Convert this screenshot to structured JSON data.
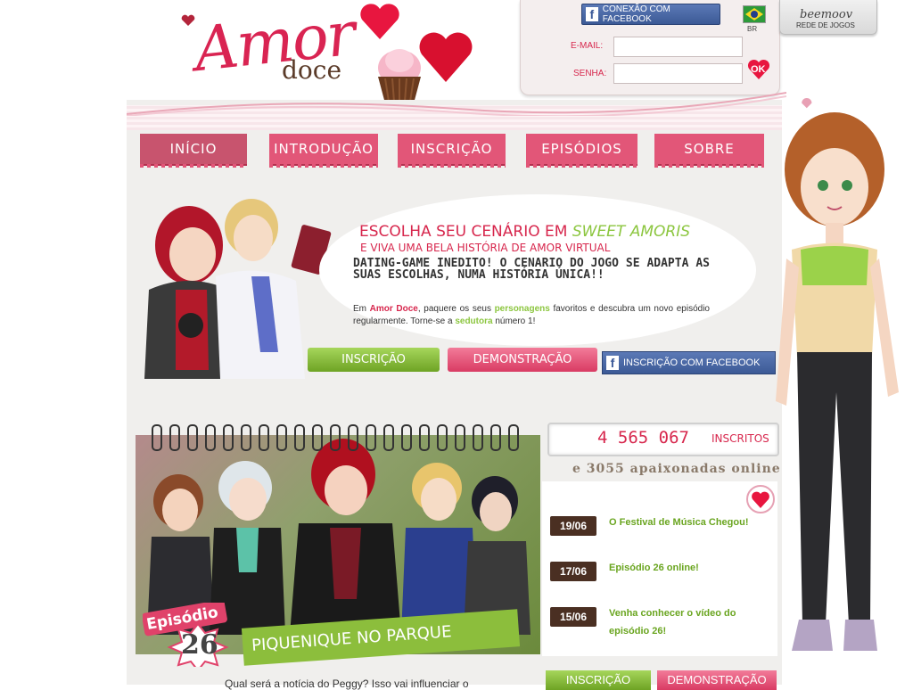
{
  "logo": {
    "amor": "Amor",
    "doce": "doce"
  },
  "login": {
    "fb_connect_label": "CONEXÃO COM FACEBOOK",
    "flag_label": "BR",
    "email_label": "E-MAIL:",
    "email_value": "",
    "senha_label": "SENHA:",
    "senha_value": "",
    "ok_label": "OK"
  },
  "beemoov": {
    "logo": "beemoov",
    "subtitle": "REDE DE JOGOS"
  },
  "nav": {
    "inicio": "INÍCIO",
    "introducao": "INTRODUÇÃO",
    "inscricao": "INSCRIÇÃO",
    "episodios": "EPISÓDIOS",
    "sobre": "SOBRE"
  },
  "hero": {
    "title_prefix": "ESCOLHA SEU CENÁRIO EM ",
    "title_em": "SWEET AMORIS",
    "subtitle": "E VIVA UMA BELA HISTÓRIA DE AMOR VIRTUAL",
    "bold_text": "DATING-GAME INEDITO! O CENARIO DO JOGO SE ADAPTA AS SUAS ESCOLHAS, NUMA HISTÓRIA ÚNICA!!",
    "body_1": "Em ",
    "body_amor_doce": "Amor Doce",
    "body_2": ", paquere os seus ",
    "body_personagens": "personagens",
    "body_3": " favoritos e descubra um novo episódio regularmente. Torne-se a ",
    "body_sedutora": "sedutora",
    "body_4": " número 1!",
    "btn_inscricao": "INSCRIÇÃO",
    "btn_demo": "DEMONSTRAÇÃO",
    "btn_fb": "INSCRIÇÃO COM FACEBOOK"
  },
  "episode": {
    "label": "Episódio",
    "number": "26",
    "title": "PIQUENIQUE NO PARQUE",
    "teaser": "Qual será a notícia do Peggy? Isso vai influenciar o"
  },
  "stats": {
    "count": "4 565 067",
    "count_label": "INSCRITOS",
    "online": "e 3055 apaixonadas online"
  },
  "news": [
    {
      "date": "19/06",
      "text": "O Festival de Música Chegou!"
    },
    {
      "date": "17/06",
      "text": "Episódio 26 online!"
    },
    {
      "date": "15/06",
      "text": "Venha conhecer o vídeo do episódio 26!"
    }
  ],
  "bottom_buttons": {
    "inscricao": "INSCRIÇÃO",
    "demo": "DEMONSTRAÇÃO"
  },
  "colors": {
    "pink": "#d7274d",
    "green": "#8cc63f",
    "facebook": "#3b5998",
    "brown": "#4a2f22"
  }
}
